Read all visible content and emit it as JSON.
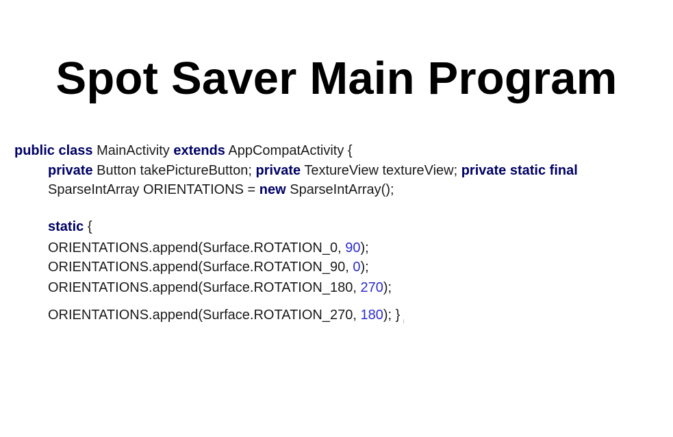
{
  "title": "Spot Saver Main Program",
  "code": {
    "line1": {
      "kw_public": "public",
      "kw_class": "class",
      "name": "MainActivity",
      "kw_extends": "extends",
      "parent": "AppCompatActivity {"
    },
    "line2": {
      "kw_private1": "private",
      "decl1": "Button takePictureButton;",
      "kw_private2": "private",
      "decl2": "TextureView textureView;",
      "kw_private_static_final": "private static final"
    },
    "line3": {
      "decl": "SparseIntArray ORIENTATIONS =",
      "kw_new": "new",
      "ctor": "SparseIntArray();"
    },
    "line4": {
      "kw_static": "static",
      "brace": "{"
    },
    "append_lines": [
      {
        "prefix": "ORIENTATIONS.append(Surface.ROTATION_0,",
        "value": "90",
        "suffix": ");"
      },
      {
        "prefix": "ORIENTATIONS.append(Surface.ROTATION_90,",
        "value": "0",
        "suffix": ");"
      },
      {
        "prefix": "ORIENTATIONS.append(Surface.ROTATION_180,",
        "value": "270",
        "suffix": ");"
      },
      {
        "prefix": "ORIENTATIONS.append(Surface.ROTATION_270,",
        "value": "180",
        "suffix": "); }"
      }
    ]
  },
  "colors": {
    "keyword": "#000066",
    "number": "#2b2bcc",
    "text": "#1a1a1a",
    "title": "#000000"
  }
}
